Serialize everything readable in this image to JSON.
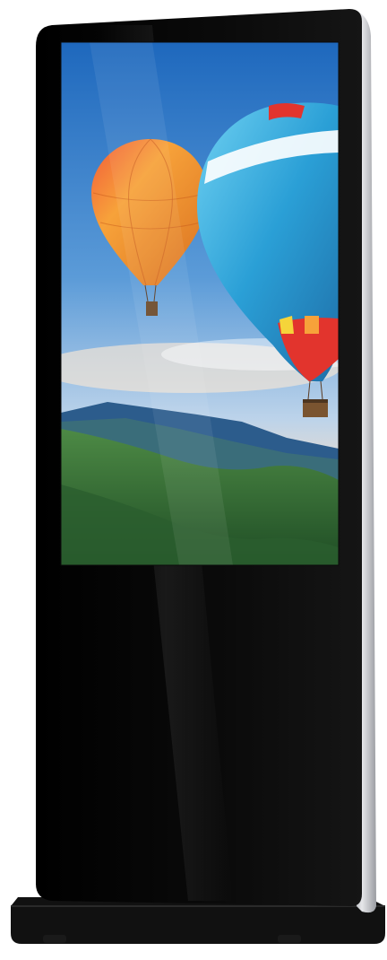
{
  "product": {
    "name": "floor-standing-digital-signage-kiosk",
    "body_color": "#050505",
    "frame_color": "#c9cbcf"
  },
  "screen_content": {
    "subject": "hot-air-balloons-over-mountains",
    "colors": {
      "sky_top": "#1f6fc4",
      "sky_bottom": "#cfdcec",
      "mountain_far": "#2e5a8a",
      "forest": "#2f6a35",
      "balloon_left": "#f28a2a",
      "balloon_right": "#2aa3d8",
      "balloon_red": "#e2342d"
    }
  }
}
